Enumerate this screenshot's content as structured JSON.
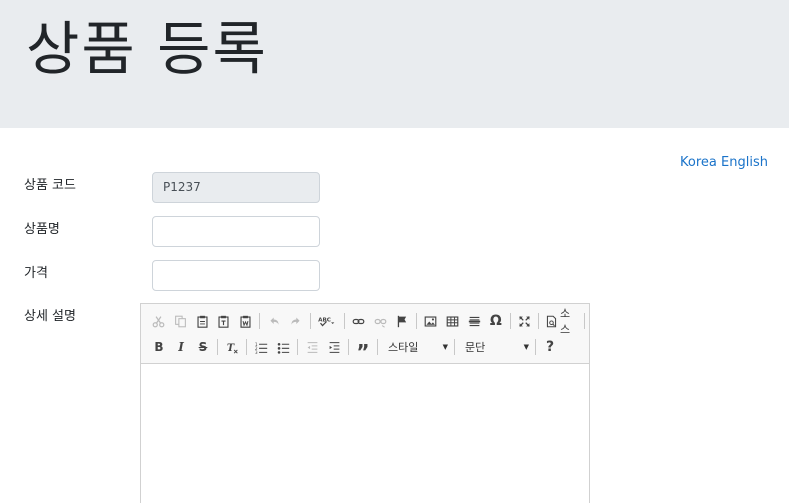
{
  "header": {
    "title": "상품 등록"
  },
  "lang": {
    "korea": "Korea",
    "english": "English"
  },
  "form": {
    "code": {
      "label": "상품 코드",
      "value": "P1237"
    },
    "name": {
      "label": "상품명",
      "value": ""
    },
    "price": {
      "label": "가격",
      "value": ""
    },
    "desc": {
      "label": "상세 설명"
    }
  },
  "editor": {
    "source_label": "소스",
    "style_combo": "스타일",
    "format_combo": "문단",
    "help": "?"
  }
}
